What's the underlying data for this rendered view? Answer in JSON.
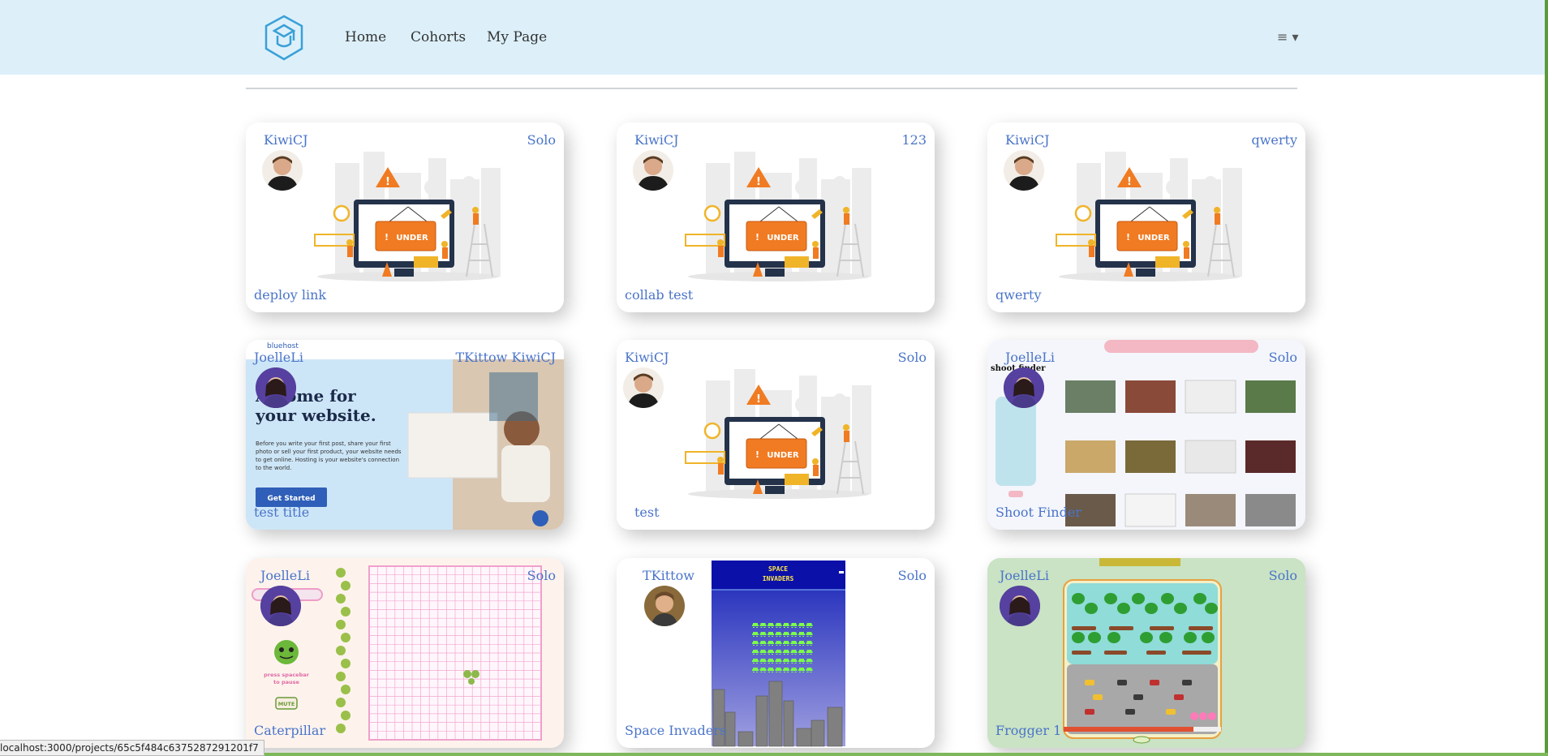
{
  "nav": {
    "links": [
      "Home",
      "Cohorts",
      "My Page"
    ],
    "menu_icon": "≡ ▾"
  },
  "projects": [
    {
      "owner": "KiwiCJ",
      "type": "Solo",
      "title": "deploy link",
      "thumbnail": "under-construction"
    },
    {
      "owner": "KiwiCJ",
      "type": "123",
      "title": "collab test",
      "thumbnail": "under-construction"
    },
    {
      "owner": "KiwiCJ",
      "type": "qwerty",
      "title": "qwerty",
      "thumbnail": "under-construction"
    },
    {
      "owner": "JoelleLi",
      "type": "TKittow KiwiCJ",
      "title": "test title",
      "thumbnail": "hosting-site",
      "preview": {
        "headline": "A home for your website.",
        "body": "Before you write your first post, share your first photo or sell your first product, your website needs to get online. Hosting is your website's connection to the world.",
        "cta": "Get Started",
        "brand": "bluehost"
      }
    },
    {
      "owner": "KiwiCJ",
      "type": "Solo",
      "title": "test",
      "thumbnail": "under-construction"
    },
    {
      "owner": "JoelleLi",
      "type": "Solo",
      "title": "Shoot Finder",
      "thumbnail": "shoot-finder"
    },
    {
      "owner": "JoelleLi",
      "type": "Solo",
      "title": "Caterpillar",
      "thumbnail": "caterpillar",
      "preview": {
        "hint": "press spacebar to pause",
        "button": "MUTE"
      }
    },
    {
      "owner": "TKittow",
      "type": "Solo",
      "title": "Space Invaders",
      "thumbnail": "space-invaders",
      "preview": {
        "heading": "SPACE INVADERS"
      }
    },
    {
      "owner": "JoelleLi",
      "type": "Solo",
      "title": "Frogger 1",
      "thumbnail": "frogger"
    }
  ],
  "status_bar": {
    "url": "localhost:3000/projects/65c5f484c6375287291201f7"
  },
  "colors": {
    "navbar": "#ddf0fa",
    "link": "#4a74c9",
    "accent": "#3aa0d8"
  }
}
